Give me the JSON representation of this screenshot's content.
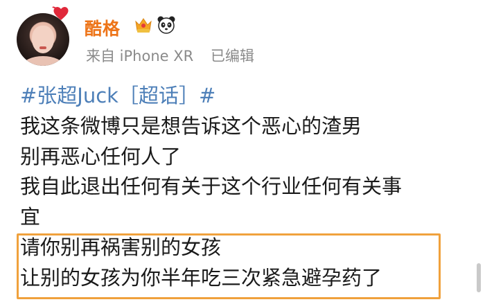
{
  "user": {
    "name": "酷格",
    "source": "来自 iPhone XR",
    "edited": "已编辑"
  },
  "post": {
    "topic": "#张超Juck［超话］#",
    "lines": [
      "我这条微博只是想告诉这个恶心的渣男",
      "别再恶心任何人了",
      "我自此退出任何有关于这个行业任何有关事",
      "宜",
      "请你别再祸害别的女孩",
      "让别的女孩为你半年吃三次紧急避孕药了"
    ]
  },
  "colors": {
    "username": "#ed7418",
    "topic": "#4d7fb8",
    "highlight_border": "#f0a13c",
    "meta": "#8a8a8a"
  },
  "icons": [
    "heart-icon",
    "crown-badge-icon",
    "panda-icon"
  ]
}
